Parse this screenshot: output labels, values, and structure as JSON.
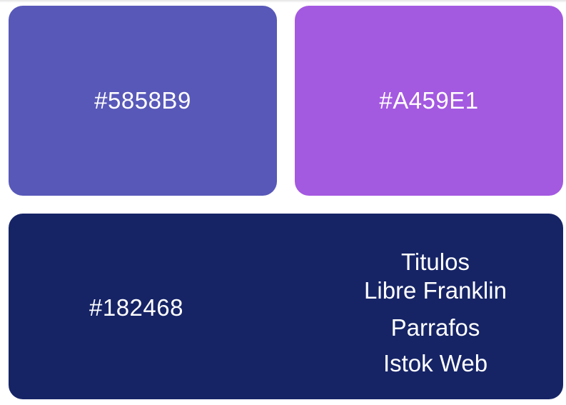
{
  "swatches": [
    {
      "hex": "#5858B9",
      "color": "#5858B9"
    },
    {
      "hex": "#A459E1",
      "color": "#A459E1"
    },
    {
      "hex": "#182468",
      "color": "#162466"
    }
  ],
  "fonts": {
    "titles_label": "Titulos",
    "titles_font": "Libre Franklin",
    "paragraphs_label": "Parrafos",
    "paragraphs_font": "Istok Web"
  }
}
